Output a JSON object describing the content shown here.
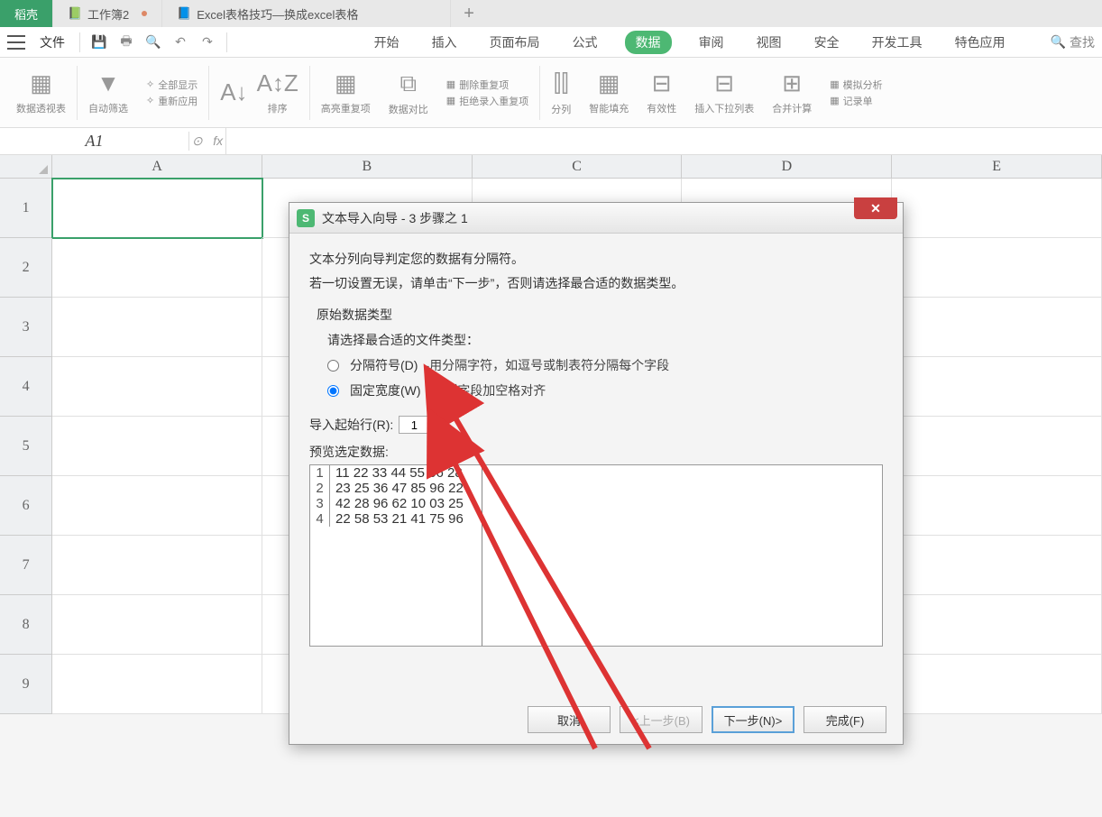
{
  "tabs": {
    "home": "稻壳",
    "wb": "工作簿2",
    "doc": "Excel表格技巧—换成excel表格"
  },
  "menu": {
    "file": "文件",
    "ribtabs": [
      "开始",
      "插入",
      "页面布局",
      "公式",
      "数据",
      "审阅",
      "视图",
      "安全",
      "开发工具",
      "特色应用"
    ],
    "search": "查找"
  },
  "ribbon": {
    "g1": "数据透视表",
    "g2": "自动筛选",
    "g2a": "全部显示",
    "g2b": "重新应用",
    "g3": "排序",
    "g4": "高亮重复项",
    "g5": "数据对比",
    "g6a": "删除重复项",
    "g6b": "拒绝录入重复项",
    "g7": "分列",
    "g8": "智能填充",
    "g9": "有效性",
    "g10": "插入下拉列表",
    "g11": "合并计算",
    "g12a": "模拟分析",
    "g12b": "记录单"
  },
  "namebox": "A1",
  "cols": [
    "A",
    "B",
    "C",
    "D",
    "E"
  ],
  "rows": [
    "1",
    "2",
    "3",
    "4",
    "5",
    "6",
    "7",
    "8",
    "9"
  ],
  "dialog": {
    "title": "文本导入向导 - 3 步骤之 1",
    "line1": "文本分列向导判定您的数据有分隔符。",
    "line2": "若一切设置无误，请单击“下一步”，否则请选择最合适的数据类型。",
    "group": "原始数据类型",
    "prompt": "请选择最合适的文件类型：",
    "opt1": "分隔符号(D)",
    "opt1d": "-用分隔字符，如逗号或制表符分隔每个字段",
    "opt2": "固定宽度(W)",
    "opt2d": "-每列字段加空格对齐",
    "startlbl": "导入起始行(R):",
    "startval": "1",
    "previewlbl": "预览选定数据:",
    "preview": [
      {
        "n": "1",
        "d": "11 22 33 44 55 66 28"
      },
      {
        "n": "2",
        "d": "23 25 36 47 85 96 22"
      },
      {
        "n": "3",
        "d": "42 28 96 62 10 03 25"
      },
      {
        "n": "4",
        "d": "22 58 53 21 41 75 96"
      }
    ],
    "btn_cancel": "取消",
    "btn_prev": "<上一步(B)",
    "btn_next": "下一步(N)>",
    "btn_finish": "完成(F)"
  }
}
